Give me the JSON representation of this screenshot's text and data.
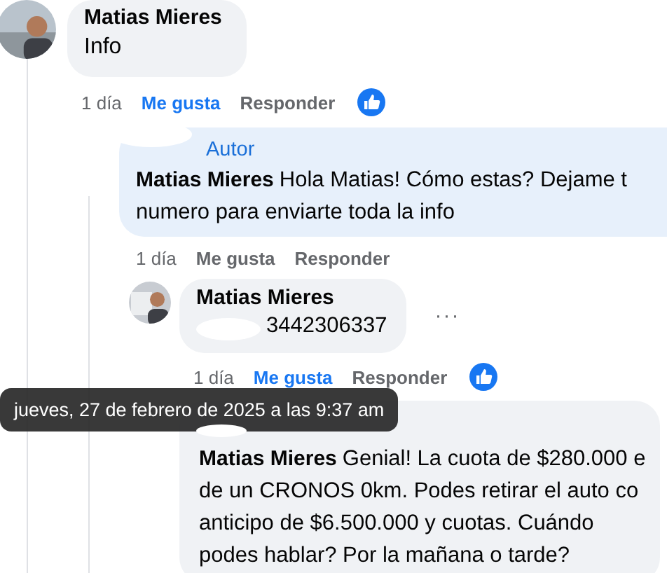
{
  "comments": [
    {
      "author": "Matias Mieres",
      "lines": [
        "Info"
      ],
      "time": "1 día",
      "like_label": "Me gusta",
      "liked": true,
      "reply_label": "Responder",
      "reacted": true,
      "avatar": true,
      "children": [
        {
          "author": "Matias Mieres",
          "badge": "Autor",
          "lines": [
            "Hola Matias! Cómo estas? Dejame t",
            "numero para enviarte toda la info"
          ],
          "time": "1 día",
          "like_label": "Me gusta",
          "liked": false,
          "reply_label": "Responder",
          "children": [
            {
              "author": "Matias Mieres",
              "lines": [
                "3442306337"
              ],
              "time": "1 día",
              "like_label": "Me gusta",
              "liked": true,
              "reply_label": "Responder",
              "reacted": true,
              "avatar": true,
              "more": "···"
            },
            {
              "author": "Matias Mieres",
              "lines": [
                "Genial! La cuota de $280.000 e",
                "de un CRONOS 0km. Podes retirar el auto co",
                "anticipo de $6.500.000 y cuotas. Cuándo",
                "podes hablar? Por la mañana o tarde?"
              ]
            }
          ]
        }
      ]
    }
  ],
  "tooltip": {
    "text": "jueves, 27 de febrero de 2025 a las 9:37 am"
  }
}
